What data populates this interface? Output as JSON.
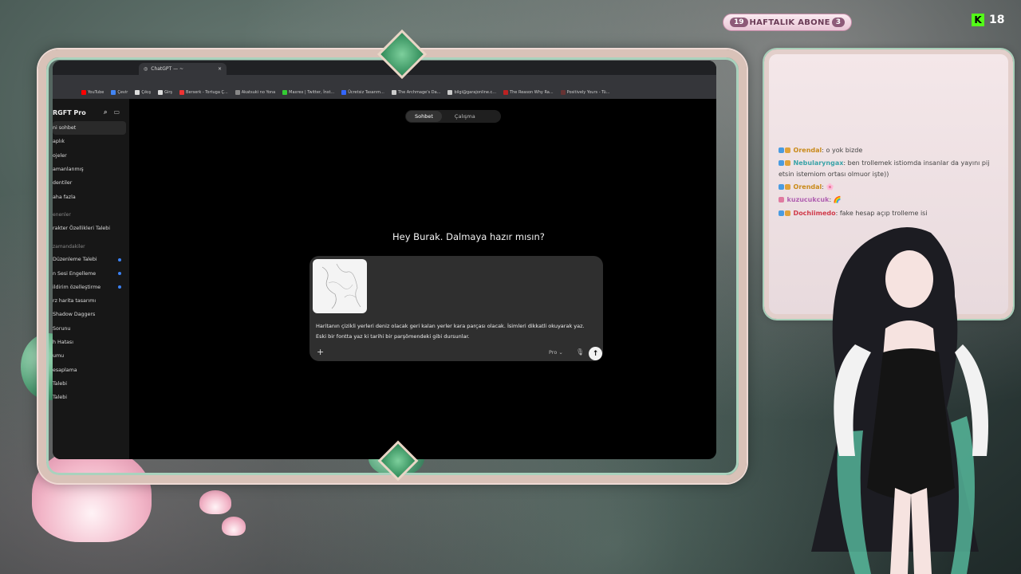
{
  "subscriber_goal": {
    "current": "19",
    "label": "HAFTALIK ABONE",
    "goal": "3"
  },
  "kick": {
    "icon": "kick-logo-icon",
    "count": "18"
  },
  "browser": {
    "tab_title": "ChatGPT — ~",
    "tab_close": "×",
    "bookmarks": [
      "YouTube",
      "Çevir",
      "Çıkış",
      "Girş",
      "Berserk - Tortuga Ç...",
      "Akatsuki no Yona",
      "Maxrex | Twitter, İnst...",
      "Ücretsiz Tasarım...",
      "The Archmage's Da...",
      "bilgi@garajonline.c...",
      "The Reason Why Ra...",
      "Positively Yours - Tü..."
    ]
  },
  "sidebar": {
    "title": "RGFT Pro",
    "items": [
      "ni sohbet",
      "aplık",
      "ojeler",
      "amanlanmış",
      "dentiler",
      "aha fazla"
    ],
    "section_1": "enenler",
    "recent_top": [
      "rakter Özellikleri Talebi"
    ],
    "section_2": "zamandakiler",
    "history": [
      "Düzenleme Talebi",
      "n Sesi Engelleme",
      "ildirim özelleştirme",
      "rz harita tasarımı",
      "Shadow Daggers",
      "Sorunu",
      "h Hatası",
      "umu",
      "esaplama",
      "Talebi",
      "Talebi"
    ]
  },
  "main": {
    "tab_chat": "Sohbet",
    "tab_work": "Çalışma",
    "heading": "Hey Burak. Dalmaya hazır mısın?",
    "prompt_line1": "Haritanın çizikli yerleri deniz olacak geri kalan yerler kara parçası olacak. İsimleri dikkatli okuyarak yaz.",
    "prompt_line2": "Eski bir fontta yaz ki tarihi bir parşömendeki gibi dursunlar.",
    "plus": "+",
    "model": "Pro",
    "mic_icon": "microphone-icon",
    "send_icon": "arrow-up-icon"
  },
  "chat": [
    {
      "user": "Orendal",
      "color": "#c98a1a",
      "text": ": o yok bizde"
    },
    {
      "user": "Nebularyngax",
      "color": "#3aa3a8",
      "text": ": ben trollemek istiomda insanlar da yayını pij"
    },
    {
      "user": "",
      "color": "#444444",
      "text": "etsin istemiom ortası olmuor işte))"
    },
    {
      "user": "Orendal",
      "color": "#c98a1a",
      "text": ":"
    },
    {
      "user": "kuzucukcuk",
      "color": "#b05fb0",
      "text": ":"
    },
    {
      "user": "Dochiimedo",
      "color": "#d03a4a",
      "text": ": fake hesap açıp trolleme isi"
    }
  ],
  "colors": {
    "accent_pink": "#e9c6d6",
    "jade": "#4f9d74",
    "chat_bg": "#000000"
  }
}
